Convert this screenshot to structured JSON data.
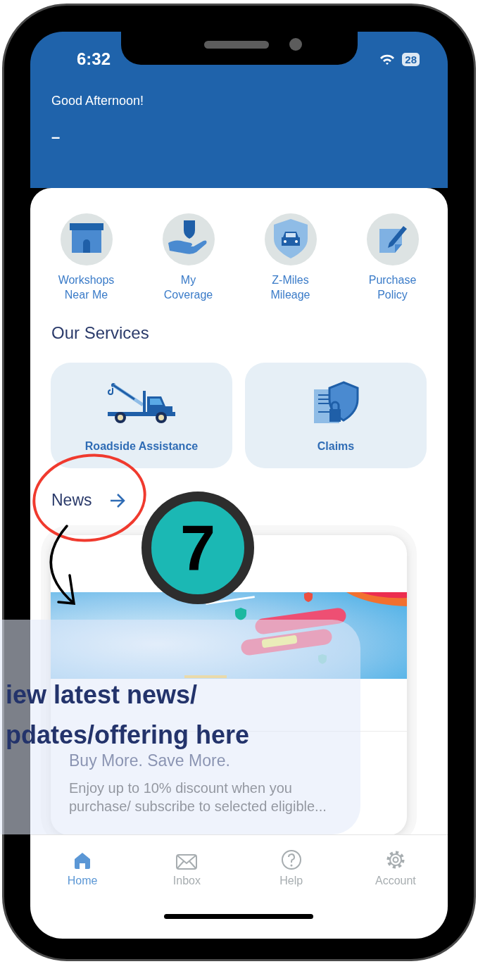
{
  "status_bar": {
    "time": "6:32",
    "battery": "28"
  },
  "header": {
    "greeting": "Good Afternoon!",
    "user_name": "–"
  },
  "quick_actions": [
    {
      "label": "Workshops\nNear Me",
      "kind": "store"
    },
    {
      "label": "My\nCoverage",
      "kind": "coverage"
    },
    {
      "label": "Z-Miles\nMileage",
      "kind": "car"
    },
    {
      "label": "Purchase\nPolicy",
      "kind": "policy"
    }
  ],
  "services": {
    "title": "Our Services",
    "items": [
      {
        "label": "Roadside Assistance",
        "kind": "tow"
      },
      {
        "label": "Claims",
        "kind": "claims"
      }
    ]
  },
  "news": {
    "title": "News",
    "cards": [
      {
        "kind": "picture",
        "title": "Buy More. Save More.",
        "body_lines": [
          "Enjoy up to 10% discount when you",
          "purchase/ subscribe to selected eligible..."
        ]
      }
    ]
  },
  "bottom_nav": [
    {
      "label": "Home",
      "kind": "home",
      "selected": true
    },
    {
      "label": "Inbox",
      "kind": "inbox",
      "selected": false
    },
    {
      "label": "Help",
      "kind": "help",
      "selected": false
    },
    {
      "label": "Account",
      "kind": "account",
      "selected": false
    }
  ],
  "annotation": {
    "step": "7",
    "callout_lines": [
      "iew latest news/",
      "pdates/offering here"
    ]
  }
}
